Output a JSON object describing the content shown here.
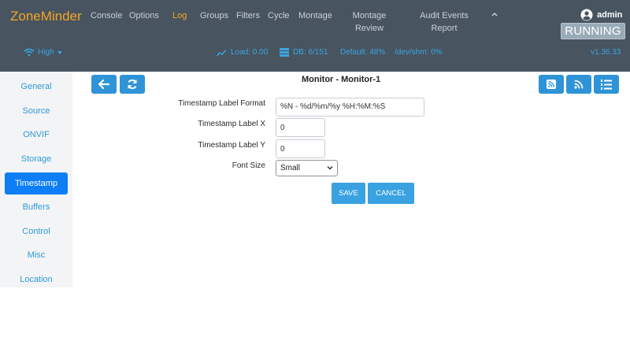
{
  "header": {
    "brand": "ZoneMinder",
    "nav": [
      {
        "label": "Console"
      },
      {
        "label": "Options"
      },
      {
        "label": "Log",
        "active": true
      },
      {
        "label": "Groups"
      },
      {
        "label": "Filters"
      },
      {
        "label": "Cycle"
      },
      {
        "label": "Montage"
      },
      {
        "label_line1": "Montage",
        "label_line2": "Review"
      },
      {
        "label_line1": "Audit Events",
        "label_line2": "Report"
      }
    ],
    "collapse_icon": "chevron-up-icon",
    "user": "admin",
    "user_icon": "user-circle-icon",
    "status": "RUNNING"
  },
  "subbar": {
    "bandwidth": "High",
    "load": "Load: 0.00",
    "db": "DB: 6/151",
    "storage": "Default: 48%",
    "shm": "/dev/shm: 0%",
    "version": "v1.36.33"
  },
  "sidebar": {
    "items": [
      {
        "label": "General"
      },
      {
        "label": "Source"
      },
      {
        "label": "ONVIF"
      },
      {
        "label": "Storage"
      },
      {
        "label": "Timestamp",
        "active": true
      },
      {
        "label": "Buffers"
      },
      {
        "label": "Control"
      },
      {
        "label": "Misc"
      },
      {
        "label": "Location"
      }
    ]
  },
  "toolbar": {
    "back_icon": "arrow-left-icon",
    "refresh_icon": "refresh-icon",
    "rss_square_icon": "rss-square-icon",
    "rss_icon": "rss-icon",
    "list_icon": "ordered-list-icon"
  },
  "page": {
    "title": "Monitor - Monitor-1"
  },
  "form": {
    "label_format_label": "Timestamp Label Format",
    "label_format_value": "%N - %d/%m/%y %H:%M:%S",
    "label_x_label": "Timestamp Label X",
    "label_x_value": "0",
    "label_y_label": "Timestamp Label Y",
    "label_y_value": "0",
    "font_size_label": "Font Size",
    "font_size_value": "Small"
  },
  "actions": {
    "save": "SAVE",
    "cancel": "CANCEL"
  },
  "colors": {
    "navbar": "#485460",
    "brand": "#f5a623",
    "accent": "#2f94d7",
    "active_tab": "#0d7ef6"
  }
}
